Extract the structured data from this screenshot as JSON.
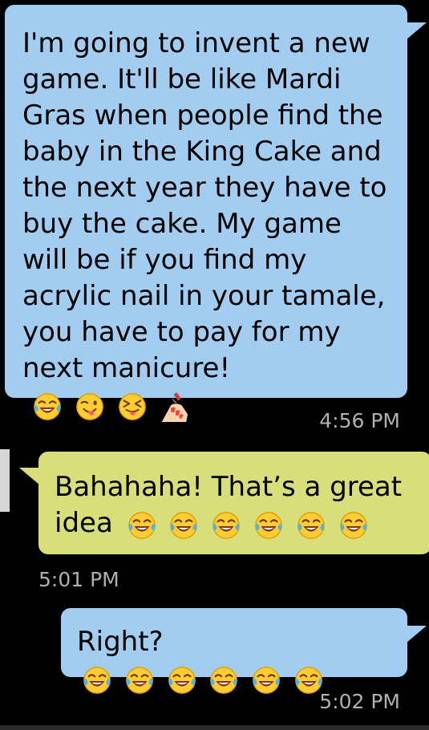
{
  "messages": [
    {
      "id": "msg1",
      "direction": "sent",
      "text": "I'm going to invent a new game. It'll be like Mardi Gras when people find the baby in the King Cake and the next year they have to buy the cake. My game will be if you find my acrylic nail in your tamale, you have to pay for my next manicure!",
      "emojis": [
        "face-with-tears-of-joy",
        "winking-face-with-tongue",
        "squinting-face-with-tongue",
        "nail-polish"
      ],
      "time": "4:56 PM"
    },
    {
      "id": "msg2",
      "direction": "received",
      "text": "Bahahaha! That’s a great idea",
      "emojis": [
        "face-with-tears-of-joy",
        "face-with-tears-of-joy",
        "face-with-tears-of-joy",
        "face-with-tears-of-joy",
        "face-with-tears-of-joy",
        "face-with-tears-of-joy"
      ],
      "time": "5:01 PM"
    },
    {
      "id": "msg3",
      "direction": "sent",
      "text": "Right?",
      "emojis": [
        "face-with-tears-of-joy",
        "face-with-tears-of-joy",
        "face-with-tears-of-joy",
        "face-with-tears-of-joy",
        "face-with-tears-of-joy",
        "face-with-tears-of-joy"
      ],
      "time": "5:02 PM"
    }
  ],
  "colors": {
    "sent_bubble": "#a3cdf0",
    "received_bubble": "#d8df7a",
    "timestamp": "#b0b0b0",
    "background": "#000000"
  }
}
